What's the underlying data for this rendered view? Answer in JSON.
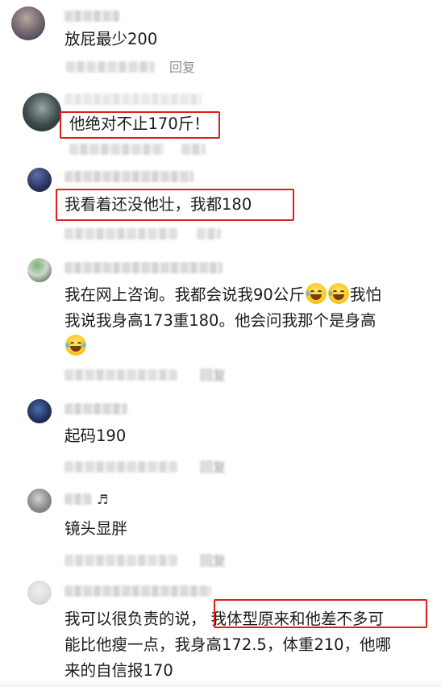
{
  "comments": [
    {
      "text": "放屁最少200",
      "reply_label": "回复"
    },
    {
      "text": "他绝对不止170斤！"
    },
    {
      "text": "我看着还没他壮，我都180"
    },
    {
      "text_line1": "我在网上咨询。我都会说我90公斤",
      "text_line1_end": "我怕",
      "text_line2": "我说我身高173重180。他会问我那个是身高",
      "reply_label": "回复"
    },
    {
      "text": "起码190",
      "reply_label": "回复"
    },
    {
      "text": "镜头显胖",
      "reply_label": "回复"
    },
    {
      "text_line1_a": "我可以很负责的说，",
      "text_line1_b": "我体型原来和他差不多可",
      "text_line2": "能比他瘦一点，我身高172.5，体重210，他哪",
      "text_line3": "来的自信报170"
    }
  ],
  "icons": {
    "emoji_a": "grinning-sweat-emoji",
    "emoji_b": "laughing-tears-emoji",
    "music": "music-note-icon"
  },
  "colors": {
    "highlight_box": "#e11d1d",
    "reply_text": "#8e8e8e"
  }
}
